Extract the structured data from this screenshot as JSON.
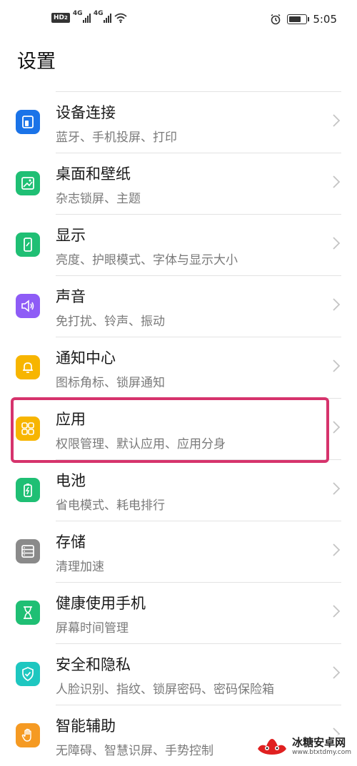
{
  "status_bar": {
    "hd_label": "HD",
    "hd_sub": "2",
    "net1": "4G",
    "net2": "4G",
    "time": "5:05"
  },
  "page_title": "设置",
  "settings": [
    {
      "title": "设备连接",
      "subtitle": "蓝牙、手机投屏、打印",
      "icon": "device-connection-icon",
      "color": "#1a73e8"
    },
    {
      "title": "桌面和壁纸",
      "subtitle": "杂志锁屏、主题",
      "icon": "wallpaper-icon",
      "color": "#1fbf74"
    },
    {
      "title": "显示",
      "subtitle": "亮度、护眼模式、字体与显示大小",
      "icon": "display-icon",
      "color": "#1fbf74"
    },
    {
      "title": "声音",
      "subtitle": "免打扰、铃声、振动",
      "icon": "sound-icon",
      "color": "#8e5cf6"
    },
    {
      "title": "通知中心",
      "subtitle": "图标角标、锁屏通知",
      "icon": "bell-icon",
      "color": "#f7b500"
    },
    {
      "title": "应用",
      "subtitle": "权限管理、默认应用、应用分身",
      "icon": "apps-grid-icon",
      "color": "#f7b500"
    },
    {
      "title": "电池",
      "subtitle": "省电模式、耗电排行",
      "icon": "battery-icon",
      "color": "#1fbf74"
    },
    {
      "title": "存储",
      "subtitle": "清理加速",
      "icon": "storage-icon",
      "color": "#8a8a8a"
    },
    {
      "title": "健康使用手机",
      "subtitle": "屏幕时间管理",
      "icon": "hourglass-icon",
      "color": "#1fbf74"
    },
    {
      "title": "安全和隐私",
      "subtitle": "人脸识别、指纹、锁屏密码、密码保险箱",
      "icon": "shield-icon",
      "color": "#1ec7c0"
    },
    {
      "title": "智能辅助",
      "subtitle": "无障碍、智慧识屏、手势控制",
      "icon": "hand-icon",
      "color": "#f59a23"
    }
  ],
  "highlight_color": "#d6336c",
  "watermark": {
    "name": "冰糖安卓网",
    "url": "www.btxtdmy.com"
  }
}
